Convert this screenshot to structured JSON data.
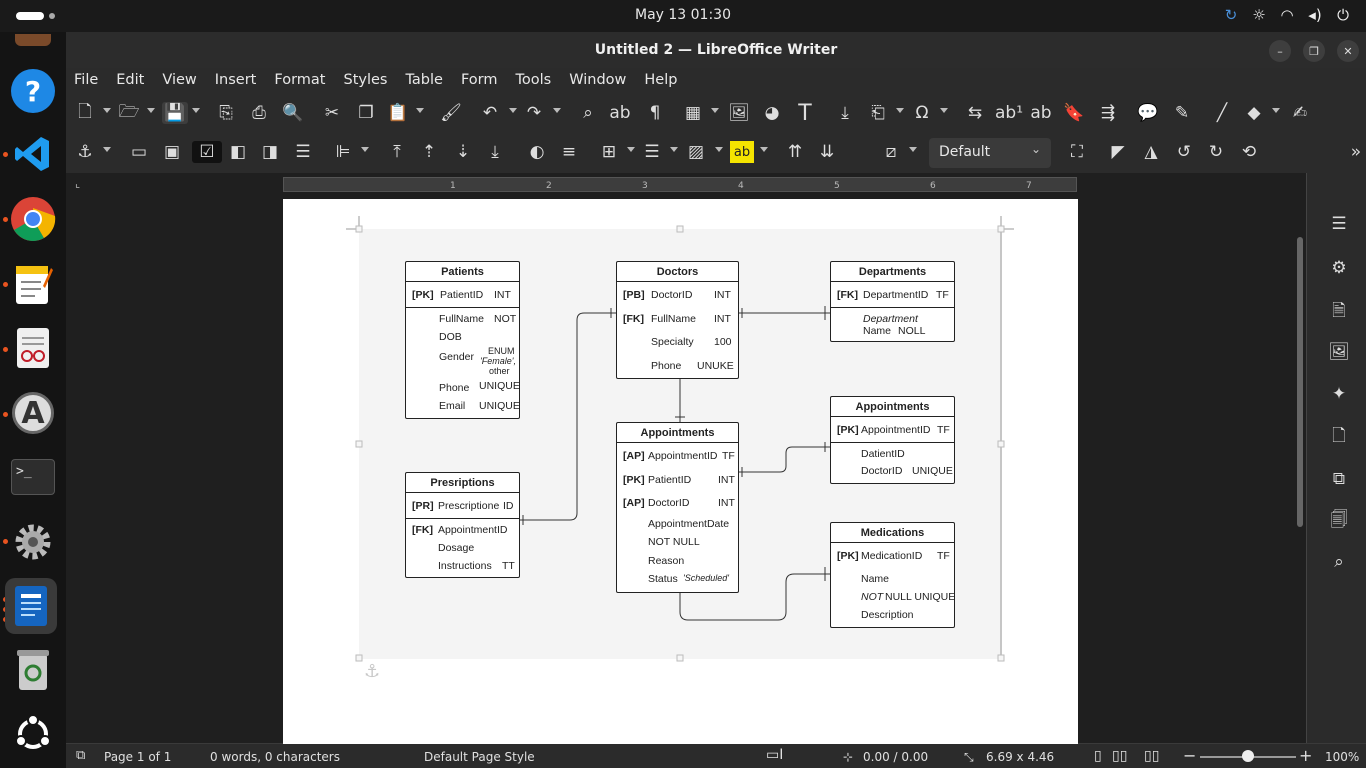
{
  "topbar": {
    "clock": "May 13  01:30"
  },
  "window": {
    "title": "Untitled 2 — LibreOffice Writer"
  },
  "menubar": {
    "items": [
      "File",
      "Edit",
      "View",
      "Insert",
      "Format",
      "Styles",
      "Table",
      "Form",
      "Tools",
      "Window",
      "Help"
    ]
  },
  "toolbar": {
    "paragraph_style": "Default"
  },
  "ruler": {
    "ticks": [
      "1",
      "2",
      "3",
      "4",
      "5",
      "6",
      "7"
    ]
  },
  "diagram": {
    "patients": {
      "title": "Patients",
      "r1_key": "[PK]",
      "r1_name": "PatientID",
      "r1_type": "INT",
      "r2_name": "FullName",
      "r2_type": "NOT",
      "r3_name": "DOB",
      "r4_name": "Gender",
      "r4_type_a": "ENUM",
      "r4_type_b": "'Female',",
      "r4_type_c": "other",
      "r5_name": "Phone",
      "r5_type": "UNIQUE",
      "r6_name": "Email",
      "r6_type": "UNIQUE"
    },
    "doctors": {
      "title": "Doctors",
      "r1_key": "[PB]",
      "r1_name": "DoctorID",
      "r1_type": "INT",
      "r2_key": "[FK]",
      "r2_name": "FullName",
      "r2_type": "INT",
      "r3_name": "Specialty",
      "r3_type": "100",
      "r4_name": "Phone",
      "r4_type": "UNUKE"
    },
    "departments": {
      "title": "Departments",
      "r1_key": "[FK]",
      "r1_name": "DepartmentID",
      "r1_type": "TF",
      "r2_name": "Department",
      "r3_name": "Name",
      "r3_type": "NOLL"
    },
    "appointments_center": {
      "title": "Appointments",
      "r1_key": "[AP]",
      "r1_name": "AppointmentID",
      "r1_type": "TF",
      "r2_key": "[PK]",
      "r2_name": "PatientID",
      "r2_type": "INT",
      "r3_key": "[AP]",
      "r3_name": "DoctorID",
      "r3_type": "INT",
      "r4_name": "AppointmentDate",
      "r5_name": "NOT NULL",
      "r6_name": "Reason",
      "r7_name": "Status",
      "r7_type": "'Scheduled'"
    },
    "appointments_right": {
      "title": "Appointments",
      "r1_key": "[PK]",
      "r1_name": "AppointmentID",
      "r1_type": "TF",
      "r2_name": "DatientID",
      "r3_name": "DoctorID",
      "r3_type": "UNIQUE"
    },
    "prescriptions": {
      "title": "Presriptions",
      "r1_key": "[PR]",
      "r1_name": "Prescriptione",
      "r1_type": "ID",
      "r2_key": "[FK]",
      "r2_name": "AppointmentID",
      "r3_name": "Dosage",
      "r4_name": "Instructions",
      "r4_type": "TT"
    },
    "medications": {
      "title": "Medications",
      "r1_key": "[PK]",
      "r1_name": "MedicationID",
      "r1_type": "TF",
      "r2_name": "Name",
      "r3_name_a": "NOT",
      "r3_name_b": "NULL UNIQUE",
      "r4_name": "Description"
    }
  },
  "statusbar": {
    "page": "Page 1 of 1",
    "words": "0 words, 0 characters",
    "page_style": "Default Page Style",
    "position": "0.00 / 0.00",
    "size": "6.69 x 4.46",
    "zoom": "100%"
  }
}
